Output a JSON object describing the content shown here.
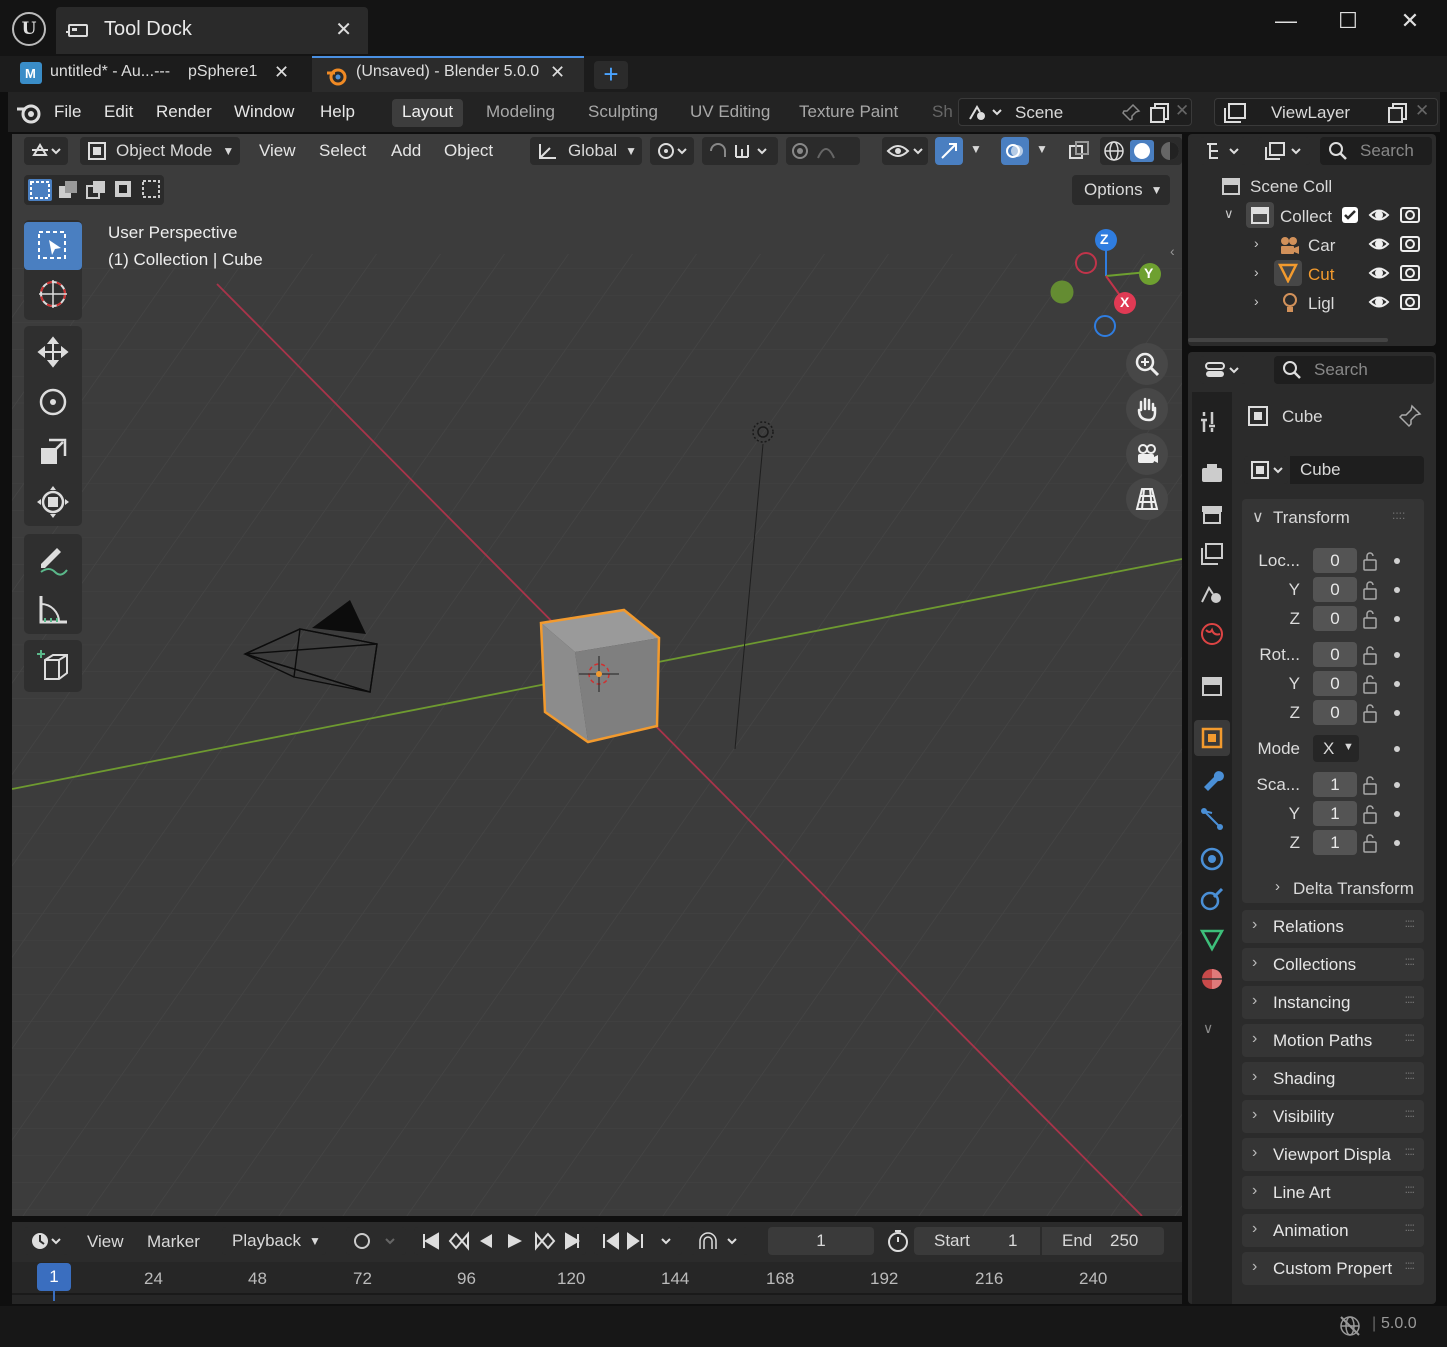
{
  "window": {
    "dock_title": "Tool Dock",
    "doc_tabs": [
      {
        "label": "untitled* - Au...---",
        "sub": "pSphere1"
      },
      {
        "label": "(Unsaved) - Blender 5.0.0"
      }
    ]
  },
  "menus": [
    "File",
    "Edit",
    "Render",
    "Window",
    "Help"
  ],
  "workspaces": [
    "Layout",
    "Modeling",
    "Sculpting",
    "UV Editing",
    "Texture Paint",
    "Sh"
  ],
  "scene": {
    "label": "Scene"
  },
  "viewlayer": {
    "label": "ViewLayer"
  },
  "viewport_header": {
    "mode": "Object Mode",
    "menus": [
      "View",
      "Select",
      "Add",
      "Object"
    ],
    "orientation": "Global",
    "options": "Options"
  },
  "viewport": {
    "perspective": "User Perspective",
    "collection_info": "(1) Collection | Cube",
    "gizmo_axes": {
      "z": "Z",
      "y": "Y",
      "x": "X"
    },
    "colors": {
      "x_axis": "#c0344a",
      "y_axis": "#6ea030",
      "z_axis": "#2f7de0",
      "selection": "#f29a2e"
    }
  },
  "timeline": {
    "menus": [
      "View",
      "Marker",
      "Playback"
    ],
    "current_frame": "1",
    "start_label": "Start",
    "start_value": "1",
    "end_label": "End",
    "end_value": "250",
    "ruler": [
      "24",
      "48",
      "72",
      "96",
      "120",
      "144",
      "168",
      "192",
      "216",
      "240"
    ],
    "playhead": "1"
  },
  "outliner": {
    "search_placeholder": "Search",
    "root": "Scene Coll",
    "collection": "Collect",
    "items": [
      "Car",
      "Cut",
      "Ligl"
    ]
  },
  "properties": {
    "search_placeholder": "Search",
    "object_name": "Cube",
    "datablock": "Cube",
    "transform": {
      "title": "Transform",
      "location_label": "Loc...",
      "location": [
        "0",
        "0",
        "0"
      ],
      "rotation_label": "Rot...",
      "rotation": [
        "0",
        "0",
        "0"
      ],
      "mode_label": "Mode",
      "mode_value": "X",
      "scale_label": "Sca...",
      "scale": [
        "1",
        "1",
        "1"
      ],
      "axis_y": "Y",
      "axis_z": "Z",
      "delta": "Delta Transform"
    },
    "panels": [
      "Relations",
      "Collections",
      "Instancing",
      "Motion Paths",
      "Shading",
      "Visibility",
      "Viewport Displa",
      "Line Art",
      "Animation",
      "Custom Propert"
    ]
  },
  "status": {
    "version": "5.0.0"
  }
}
